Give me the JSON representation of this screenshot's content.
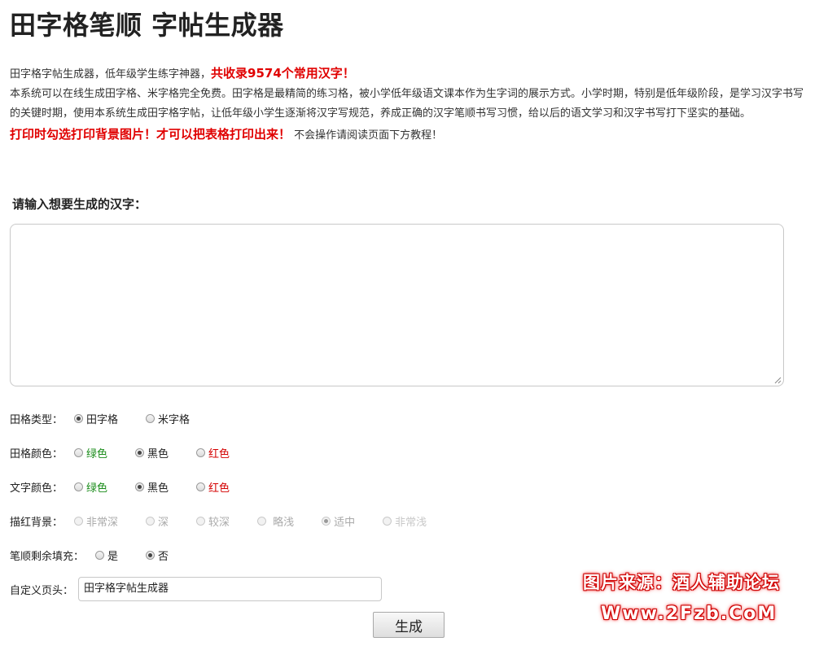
{
  "page": {
    "title": "田字格笔顺 字帖生成器"
  },
  "intro": {
    "line1_text": "田字格字帖生成器，低年级学生练字神器，",
    "line1_highlight": "共收录9574个常用汉字！",
    "paragraph": "本系统可以在线生成田字格、米字格完全免费。田字格是最精简的练习格，被小学低年级语文课本作为生字词的展示方式。小学时期，特别是低年级阶段，是学习汉字书写的关键时期，使用本系统生成田字格字帖，让低年级小学生逐渐将汉字写规范，养成正确的汉字笔顺书写习惯，给以后的语文学习和汉字书写打下坚实的基础。",
    "print_warning": "打印时勾选打印背景图片！才可以把表格打印出来！",
    "print_hint": "不会操作请阅读页面下方教程！"
  },
  "input_prompt": "请输入想要生成的汉字：",
  "textarea_value": "",
  "options": {
    "grid_type": {
      "label": "田格类型：",
      "choices": [
        "田字格",
        "米字格"
      ],
      "selected": "田字格"
    },
    "grid_color": {
      "label": "田格颜色：",
      "choices": [
        "绿色",
        "黑色",
        "红色"
      ],
      "selected": "黑色"
    },
    "text_color": {
      "label": "文字颜色：",
      "choices": [
        "绿色",
        "黑色",
        "红色"
      ],
      "selected": "黑色"
    },
    "trace_bg": {
      "label": "描红背景：",
      "choices": [
        "非常深",
        "深",
        "较深",
        "略浅",
        "适中",
        "非常浅"
      ],
      "selected": "适中",
      "disabled": true
    },
    "stroke_fill": {
      "label": "笔顺剩余填充：",
      "choices": [
        "是",
        "否"
      ],
      "selected": "否"
    }
  },
  "custom_header": {
    "label": "自定义页头：",
    "value": "田字格字帖生成器"
  },
  "generate_button": "生成",
  "watermark": {
    "line1": "图片来源：酒人辅助论坛",
    "line2": "Www.2Fzb.CoM"
  },
  "colors": {
    "accent_red": "#e00000",
    "green": "#1a8c1a",
    "red": "#d40000"
  }
}
